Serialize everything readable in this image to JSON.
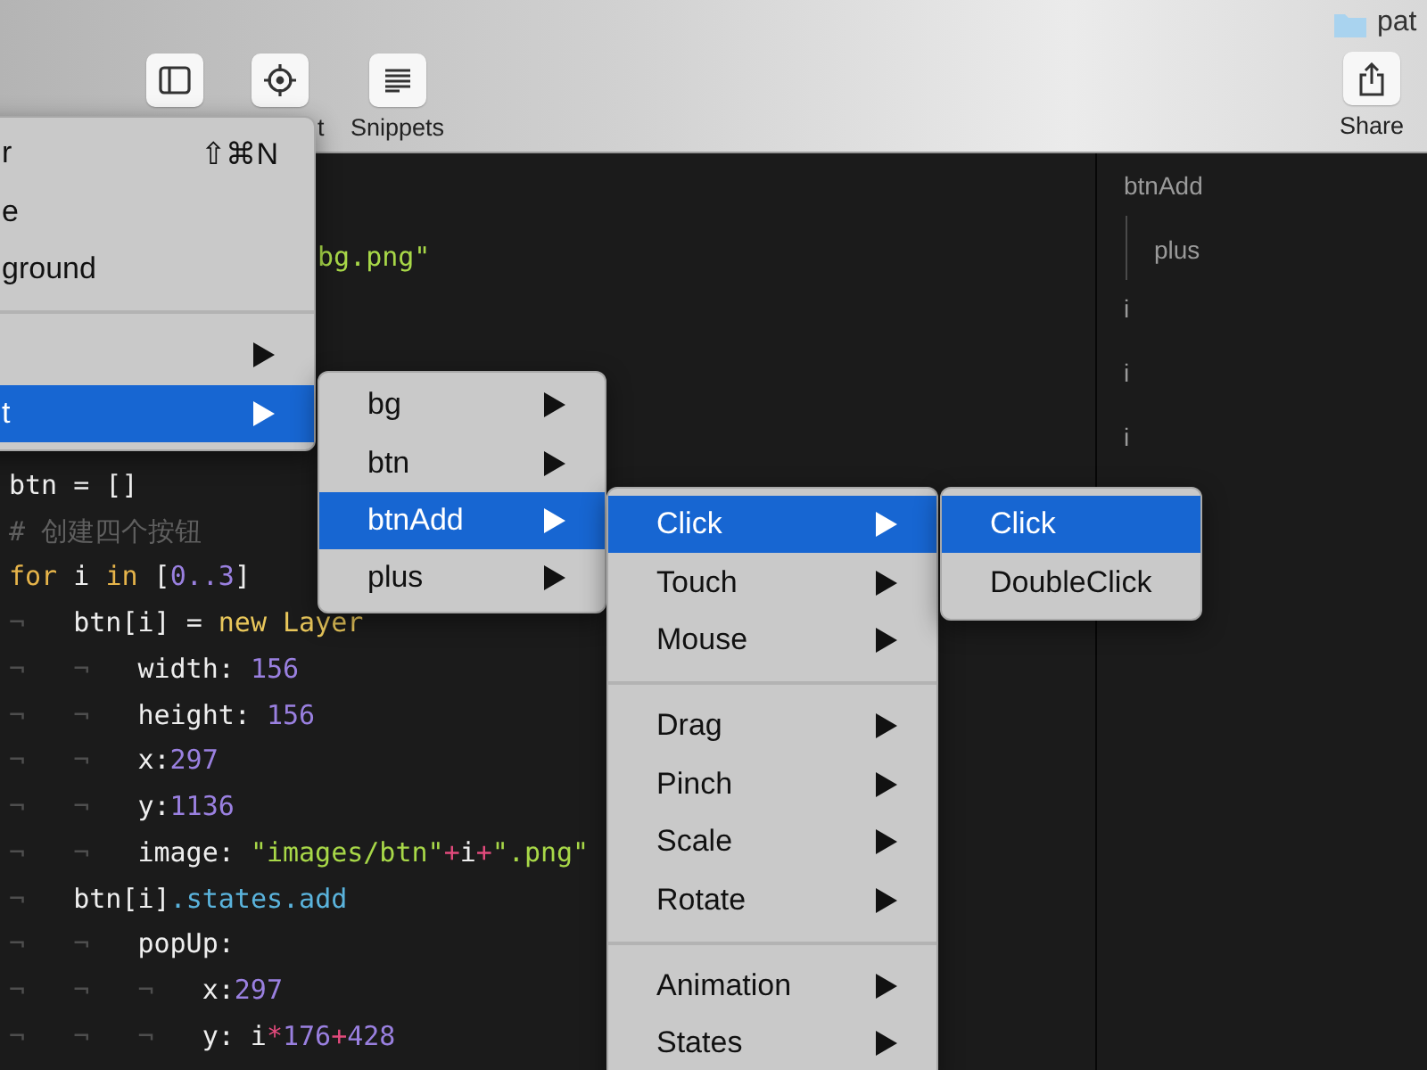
{
  "toolbar": {
    "buttons": [
      {
        "kind": "sidebar"
      },
      {
        "kind": "target",
        "label": "t"
      },
      {
        "kind": "snippets",
        "label": "Snippets"
      }
    ],
    "path": {
      "text": "pat"
    },
    "share": {
      "kind": "share",
      "label": "Share"
    }
  },
  "code_editor": {
    "fragment": [
      {
        "kind": "string",
        "text": "bg.png\""
      }
    ],
    "lines": [
      {
        "tokens": [
          {
            "kind": "plain",
            "text": "btn = []"
          }
        ]
      },
      {
        "tokens": [
          {
            "kind": "comment",
            "text": "# 创建四个按钮"
          }
        ]
      },
      {
        "tokens": [
          {
            "kind": "keyword",
            "text": "for"
          },
          {
            "kind": "plain",
            "text": " i "
          },
          {
            "kind": "keyword",
            "text": "in"
          },
          {
            "kind": "plain",
            "text": " ["
          },
          {
            "kind": "number",
            "text": "0..3"
          },
          {
            "kind": "plain",
            "text": "]"
          }
        ]
      },
      {
        "tokens": [
          {
            "kind": "tab",
            "text": "¬"
          },
          {
            "kind": "plain",
            "text": "btn[i] = "
          },
          {
            "kind": "builtin",
            "text": "new Layer"
          }
        ]
      },
      {
        "tokens": [
          {
            "kind": "tab",
            "text": "¬"
          },
          {
            "kind": "tab",
            "text": "¬"
          },
          {
            "kind": "plain",
            "text": "width: "
          },
          {
            "kind": "number",
            "text": "156"
          }
        ]
      },
      {
        "tokens": [
          {
            "kind": "tab",
            "text": "¬"
          },
          {
            "kind": "tab",
            "text": "¬"
          },
          {
            "kind": "plain",
            "text": "height: "
          },
          {
            "kind": "number",
            "text": "156"
          }
        ]
      },
      {
        "tokens": [
          {
            "kind": "tab",
            "text": "¬"
          },
          {
            "kind": "tab",
            "text": "¬"
          },
          {
            "kind": "plain",
            "text": "x:"
          },
          {
            "kind": "number",
            "text": "297"
          }
        ]
      },
      {
        "tokens": [
          {
            "kind": "tab",
            "text": "¬"
          },
          {
            "kind": "tab",
            "text": "¬"
          },
          {
            "kind": "plain",
            "text": "y:"
          },
          {
            "kind": "number",
            "text": "1136"
          }
        ]
      },
      {
        "tokens": [
          {
            "kind": "tab",
            "text": "¬"
          },
          {
            "kind": "tab",
            "text": "¬"
          },
          {
            "kind": "plain",
            "text": "image: "
          },
          {
            "kind": "string",
            "text": "\"images/btn\""
          },
          {
            "kind": "operator",
            "text": "+"
          },
          {
            "kind": "plain",
            "text": "i"
          },
          {
            "kind": "operator",
            "text": "+"
          },
          {
            "kind": "string",
            "text": "\".png\""
          }
        ]
      },
      {
        "tokens": [
          {
            "kind": "tab",
            "text": "¬"
          },
          {
            "kind": "plain",
            "text": "btn[i]"
          },
          {
            "kind": "property",
            "text": ".states.add"
          }
        ]
      },
      {
        "tokens": [
          {
            "kind": "tab",
            "text": "¬"
          },
          {
            "kind": "tab",
            "text": "¬"
          },
          {
            "kind": "plain",
            "text": "popUp:"
          }
        ]
      },
      {
        "tokens": [
          {
            "kind": "tab",
            "text": "¬"
          },
          {
            "kind": "tab",
            "text": "¬"
          },
          {
            "kind": "tab",
            "text": "¬"
          },
          {
            "kind": "plain",
            "text": "x:"
          },
          {
            "kind": "number",
            "text": "297"
          }
        ]
      },
      {
        "tokens": [
          {
            "kind": "tab",
            "text": "¬"
          },
          {
            "kind": "tab",
            "text": "¬"
          },
          {
            "kind": "tab",
            "text": "¬"
          },
          {
            "kind": "plain",
            "text": "y: i"
          },
          {
            "kind": "operator",
            "text": "*"
          },
          {
            "kind": "number",
            "text": "176"
          },
          {
            "kind": "operator",
            "text": "+"
          },
          {
            "kind": "number",
            "text": "428"
          }
        ]
      }
    ]
  },
  "outline": [
    {
      "label": "btnAdd",
      "children": [
        {
          "label": "plus"
        }
      ]
    },
    {
      "label": "i"
    },
    {
      "label": "i"
    },
    {
      "label": "i"
    }
  ],
  "menus": [
    {
      "items": [
        {
          "kind": "item",
          "label": "r",
          "shortcut": "⇧⌘N",
          "submenu": false,
          "selected": false
        },
        {
          "kind": "item",
          "label": "e",
          "submenu": false,
          "selected": false
        },
        {
          "kind": "item",
          "label": "ground",
          "submenu": false,
          "selected": false
        },
        {
          "kind": "separator"
        },
        {
          "kind": "item",
          "submenu": true,
          "selected": false
        },
        {
          "kind": "item",
          "label": "t",
          "submenu": true,
          "selected": true
        }
      ]
    },
    {
      "items": [
        {
          "kind": "item",
          "label": "bg",
          "submenu": true,
          "selected": false
        },
        {
          "kind": "item",
          "label": "btn",
          "submenu": true,
          "selected": false
        },
        {
          "kind": "item",
          "label": "btnAdd",
          "submenu": true,
          "selected": true
        },
        {
          "kind": "item",
          "label": "plus",
          "submenu": true,
          "selected": false
        }
      ]
    },
    {
      "items": [
        {
          "kind": "item",
          "label": "Click",
          "submenu": true,
          "selected": true
        },
        {
          "kind": "item",
          "label": "Touch",
          "submenu": true,
          "selected": false
        },
        {
          "kind": "item",
          "label": "Mouse",
          "submenu": true,
          "selected": false
        },
        {
          "kind": "separator"
        },
        {
          "kind": "item",
          "label": "Drag",
          "submenu": true,
          "selected": false
        },
        {
          "kind": "item",
          "label": "Pinch",
          "submenu": true,
          "selected": false
        },
        {
          "kind": "item",
          "label": "Scale",
          "submenu": true,
          "selected": false
        },
        {
          "kind": "item",
          "label": "Rotate",
          "submenu": true,
          "selected": false
        },
        {
          "kind": "separator"
        },
        {
          "kind": "item",
          "label": "Animation",
          "submenu": true,
          "selected": false
        },
        {
          "kind": "item",
          "label": "States",
          "submenu": true,
          "selected": false
        }
      ]
    },
    {
      "items": [
        {
          "kind": "item",
          "label": "Click",
          "submenu": false,
          "selected": true
        },
        {
          "kind": "item",
          "label": "DoubleClick",
          "submenu": false,
          "selected": false
        }
      ]
    }
  ]
}
